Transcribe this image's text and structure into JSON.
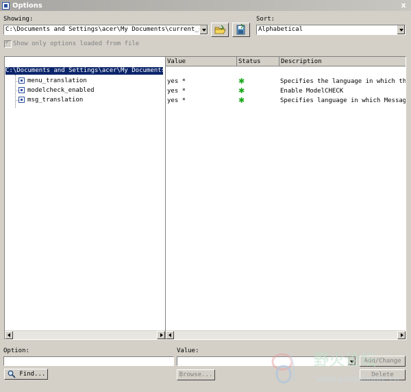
{
  "window": {
    "title": "Options",
    "close_glyph": "x"
  },
  "showing": {
    "label": "Showing:",
    "value": "C:\\Documents and Settings\\acer\\My Documents\\current_session.pro"
  },
  "toolbar": {
    "open_icon": "folder-open-icon",
    "save_icon": "save-config-icon"
  },
  "sort": {
    "label": "Sort:",
    "value": "Alphabetical"
  },
  "show_only_loaded": {
    "label": "Show only options loaded from file",
    "checked": true,
    "enabled": false
  },
  "tree": {
    "root": "C:\\Documents and Settings\\acer\\My Documents\\current_session.pro",
    "items": [
      {
        "name": "menu_translation"
      },
      {
        "name": "modelcheck_enabled"
      },
      {
        "name": "msg_translation"
      }
    ]
  },
  "table": {
    "headers": {
      "value": "Value",
      "status": "Status",
      "description": "Description"
    },
    "rows": [
      {
        "value": "yes *",
        "status_icon": "green-star-icon",
        "description": "Specifies the language in which the menus"
      },
      {
        "value": "yes *",
        "status_icon": "green-star-icon",
        "description": "Enable ModelCHECK"
      },
      {
        "value": "yes *",
        "status_icon": "green-star-icon",
        "description": "Specifies language in which Messages are"
      }
    ]
  },
  "bottom": {
    "option_label": "Option:",
    "option_value": "",
    "value_label": "Value:",
    "value_value": "",
    "find_label": "Find...",
    "browse_label": "Browse...",
    "add_change_label": "Add/Change",
    "delete_label": "Delete"
  },
  "watermark": {
    "text": "野火论坛",
    "url": "www.proewildfire.cn"
  },
  "colors": {
    "selection": "#0a246a",
    "status_green": "#1aa81a",
    "face": "#d4d0c8"
  }
}
